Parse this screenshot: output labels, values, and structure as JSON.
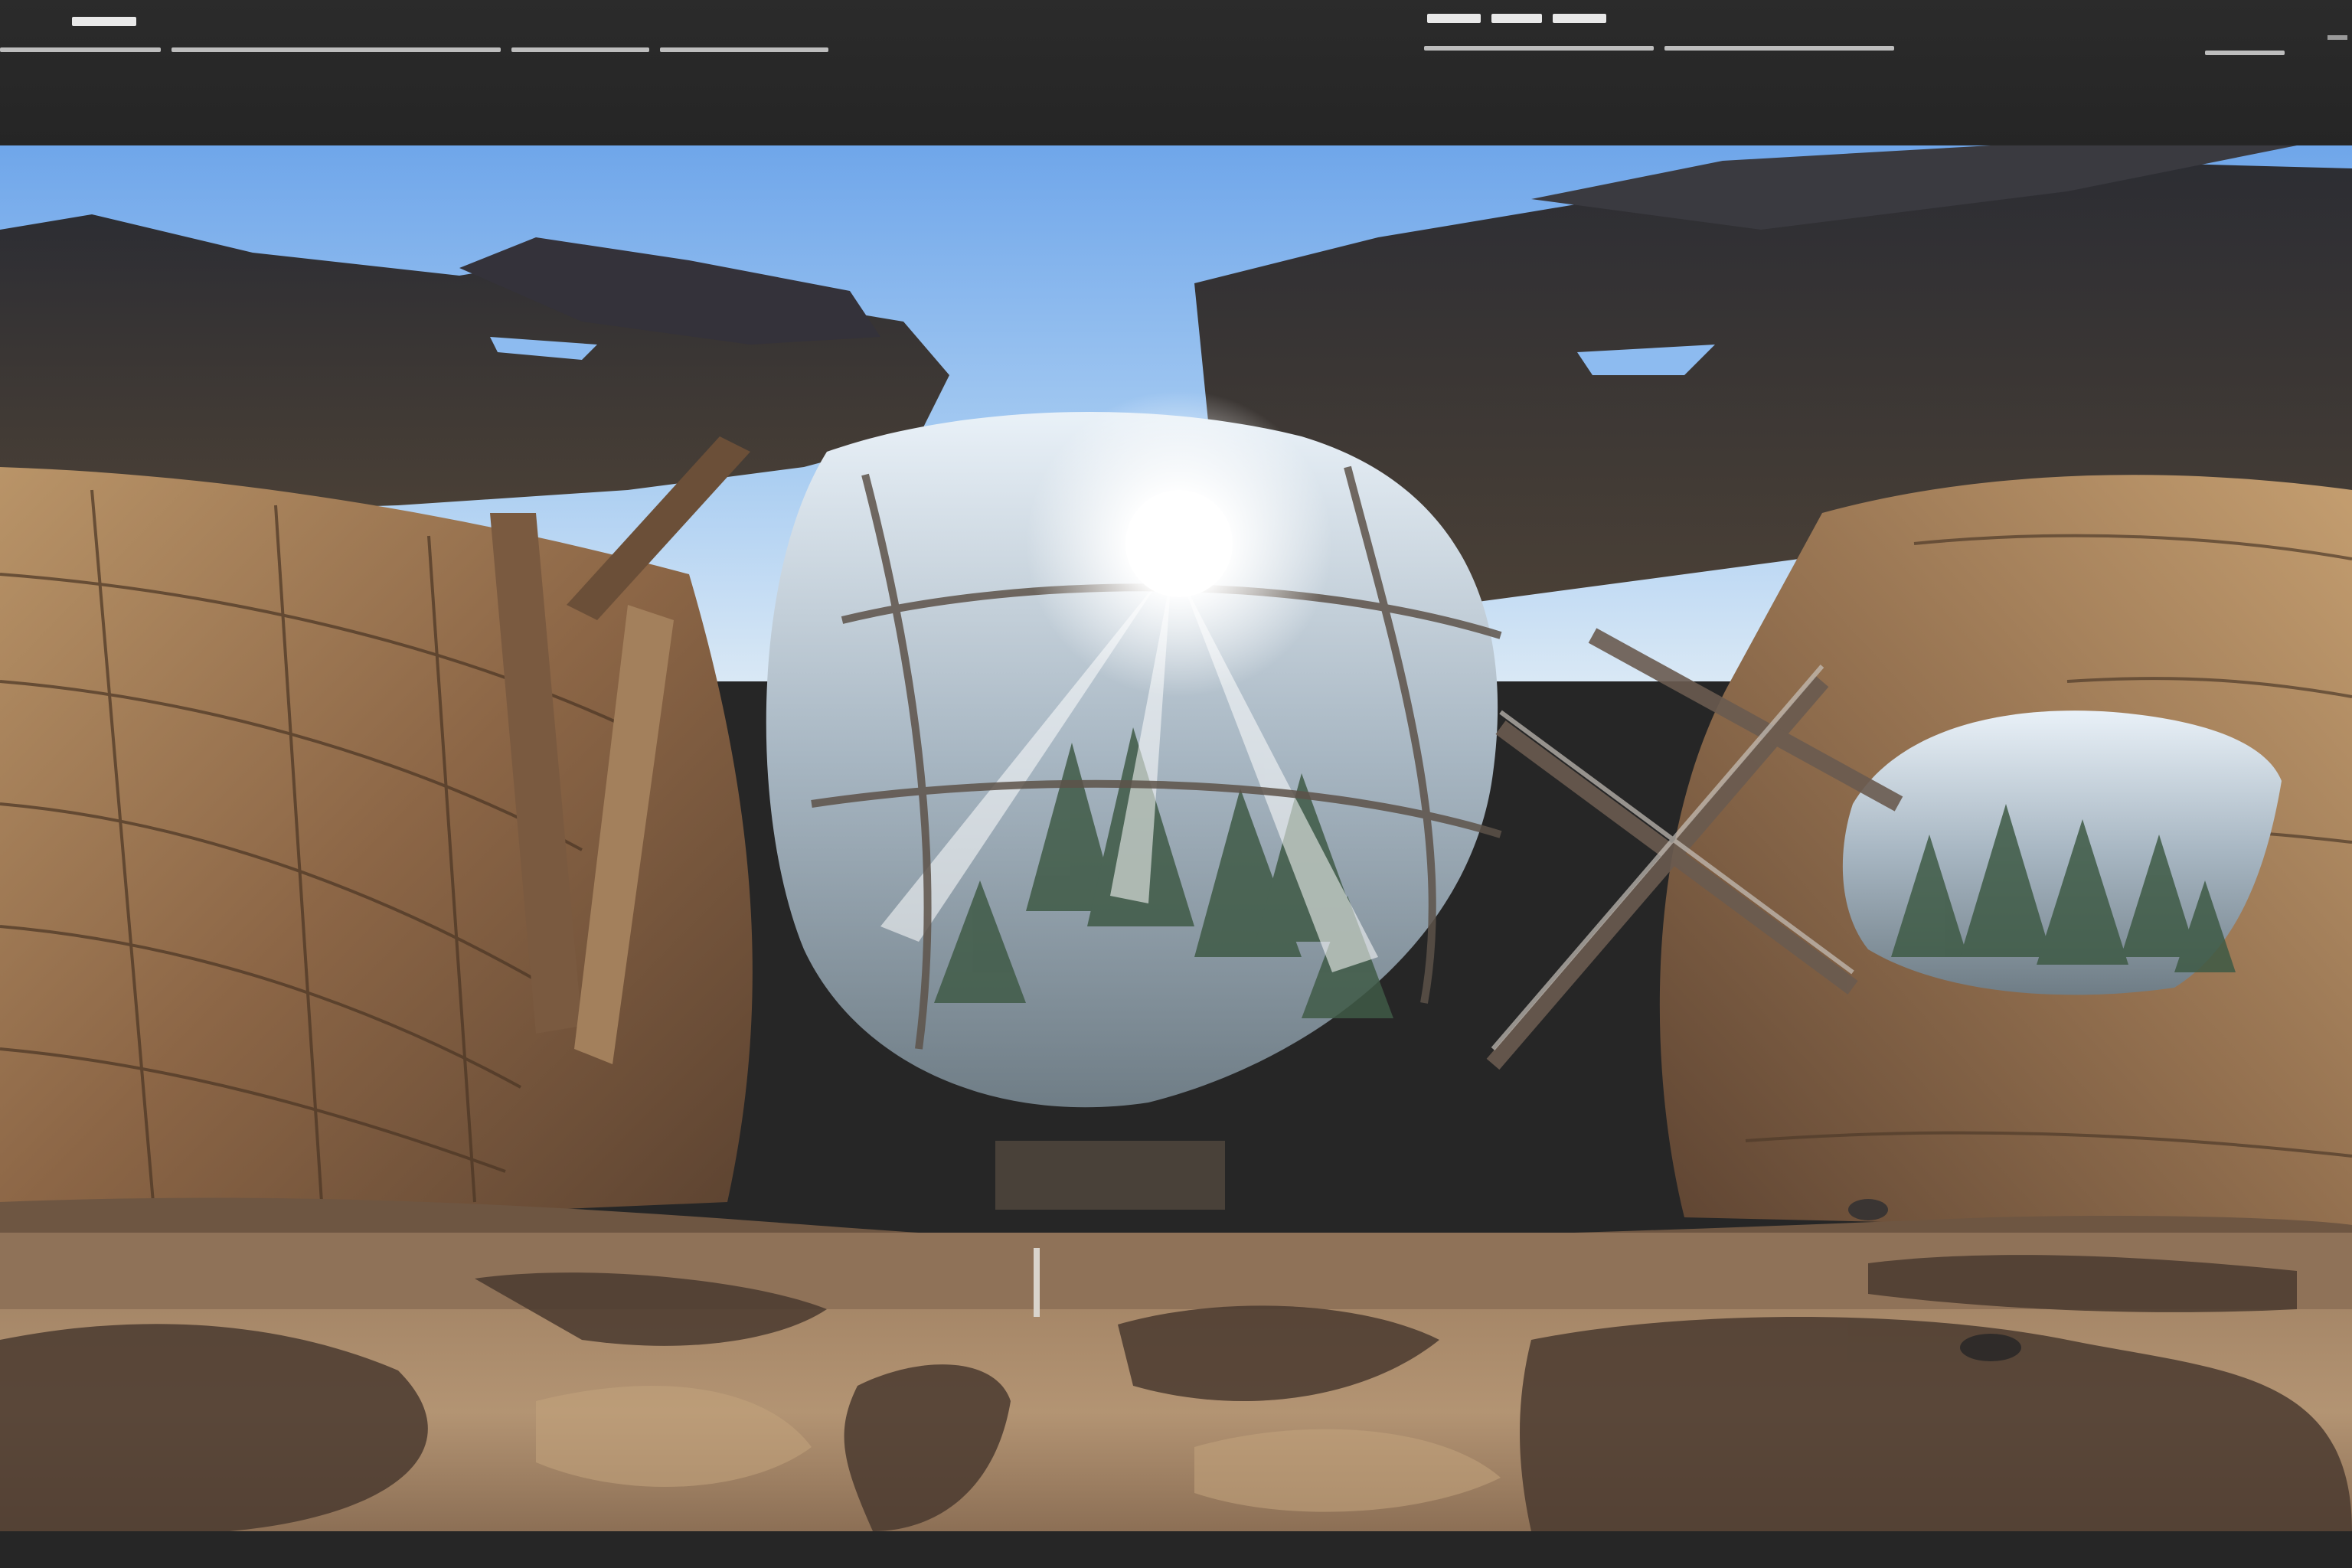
{
  "image": {
    "kind": "equirectangular 360 panorama",
    "subject_colors": {
      "sky": "#7fb2ee",
      "sky_light": "#cfe3f7",
      "sun": "#ffffff",
      "wood_light": "#c9a77a",
      "wood_mid": "#9a7452",
      "wood_dark": "#4e3a2a",
      "foliage_dark": "#2a2a2e",
      "trees": "#4d6a4e",
      "floor_light": "#b69875",
      "floor_shadow": "#4b3b30",
      "window_glass": "#8f98a3"
    }
  },
  "ui": {
    "bar_color": "#262626",
    "mark_color": "#e8e8e8"
  }
}
